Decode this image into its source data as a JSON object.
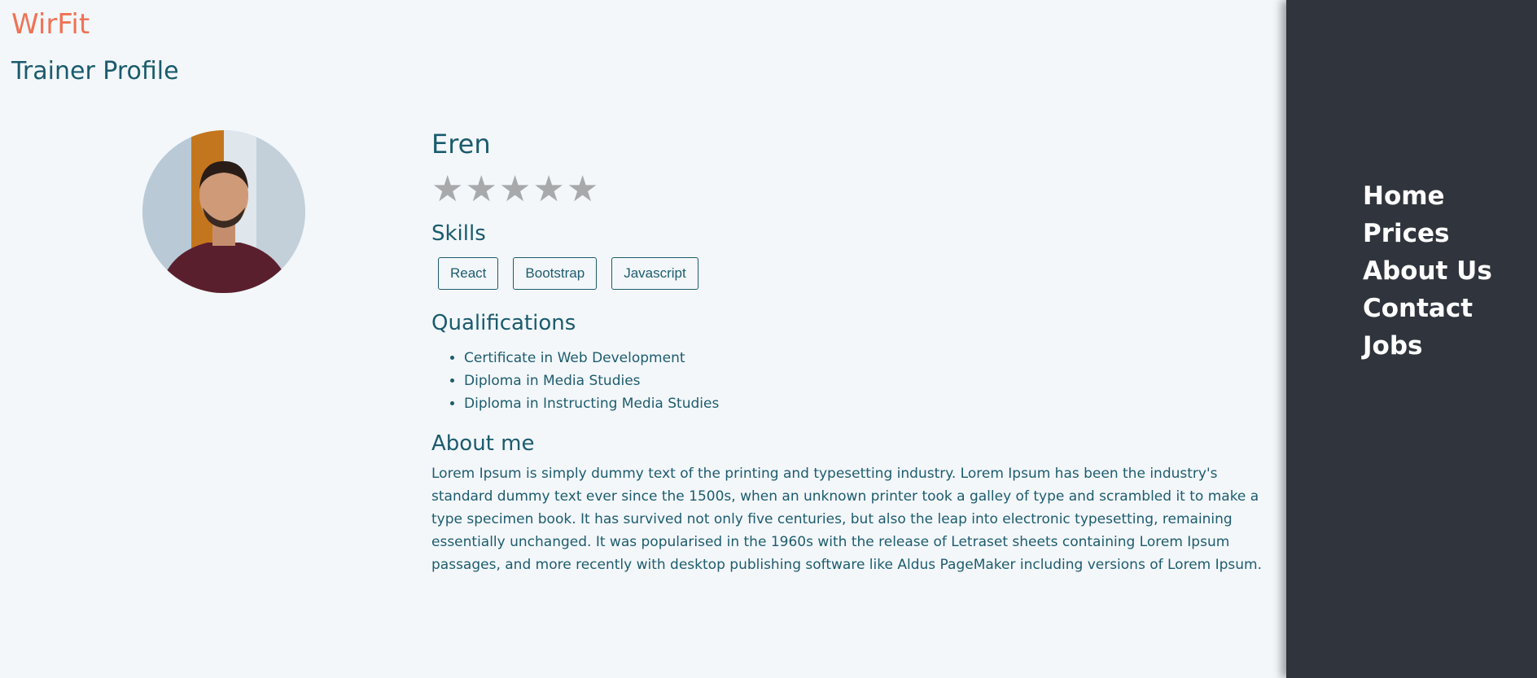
{
  "brand": "WirFit",
  "page_title": "Trainer Profile",
  "trainer": {
    "name": "Eren",
    "rating": {
      "filled": 0,
      "max": 5,
      "star_color": "#a7a9ab"
    }
  },
  "skills": {
    "title": "Skills",
    "items": [
      "React",
      "Bootstrap",
      "Javascript"
    ]
  },
  "qualifications": {
    "title": "Qualifications",
    "items": [
      "Certificate in Web Development",
      "Diploma in Media Studies",
      "Diploma in Instructing Media Studies"
    ]
  },
  "about": {
    "title": "About me",
    "text": "Lorem Ipsum is simply dummy text of the printing and typesetting industry. Lorem Ipsum has been the industry's standard dummy text ever since the 1500s, when an unknown printer took a galley of type and scrambled it to make a type specimen book. It has survived not only five centuries, but also the leap into electronic typesetting, remaining essentially unchanged. It was popularised in the 1960s with the release of Letraset sheets containing Lorem Ipsum passages, and more recently with desktop publishing software like Aldus PageMaker including versions of Lorem Ipsum."
  },
  "nav": {
    "items": [
      "Home",
      "Prices",
      "About Us",
      "Contact",
      "Jobs"
    ]
  },
  "colors": {
    "brand": "#ef7355",
    "text": "#1d5c6e",
    "background": "#f3f7fa",
    "sidebar": "#30353d"
  }
}
